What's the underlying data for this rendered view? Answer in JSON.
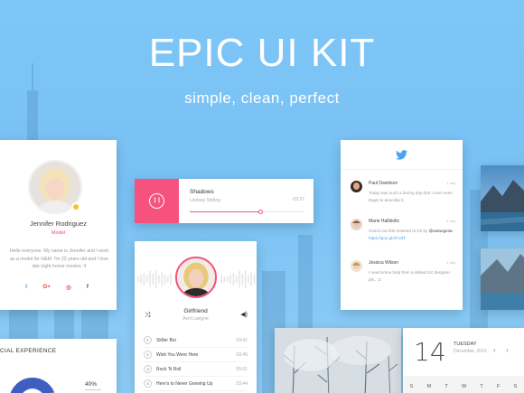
{
  "hero": {
    "title": "EPIC UI KIT",
    "subtitle": "simple, clean, perfect"
  },
  "profile": {
    "name": "Jennifer Rodriguez",
    "role": "Model",
    "bio": "Hello everyone. My name is Jennifer and I work as a model for H&M. I'm 22 years old and I love late night horror movies :3",
    "socials": [
      {
        "icon": "twitter-icon",
        "glyph": "t",
        "color": "#4aa3ee"
      },
      {
        "icon": "google-plus-icon",
        "glyph": "G+",
        "color": "#dd4b39"
      },
      {
        "icon": "dribbble-icon",
        "glyph": "◎",
        "color": "#ea4c89"
      },
      {
        "icon": "facebook-icon",
        "glyph": "f",
        "color": "#3b5998"
      }
    ]
  },
  "player": {
    "song": "Shadows",
    "artist": "Lindsey Stirling",
    "time": "-03:27",
    "progress": 0.62,
    "accent": "#f7517d"
  },
  "music": {
    "title": "Girlfriend",
    "artist": "Avril Lavigne",
    "tracks": [
      {
        "num": "1",
        "title": "Sk8er Boi",
        "duration": "03:41"
      },
      {
        "num": "2",
        "title": "Wish You Were Here",
        "duration": "03:45"
      },
      {
        "num": "3",
        "title": "Rock 'N Roll",
        "duration": "05:01"
      },
      {
        "num": "4",
        "title": "Here's to Never Growing Up",
        "duration": "03:44"
      }
    ]
  },
  "twitter": {
    "tweets": [
      {
        "name": "Paul Davidson",
        "time": "1 day",
        "text": "Today was such a boring day that I can't even begin to describe it."
      },
      {
        "name": "Marie Halliboltc",
        "time": "1 day",
        "text": "Check out this material UI Kit by ",
        "handle": "@avtangiota",
        "link": " - https://goo.gl/3Y23T"
      },
      {
        "name": "Jessica Wilson",
        "time": "1 day",
        "text": "I need some help from a skilled UX designer pls.. :3"
      }
    ]
  },
  "stats": {
    "title": "CIAL EXPERIENCE",
    "percent": "40%"
  },
  "calendar": {
    "day": "14",
    "weekday": "TUESDAY",
    "month": "December, 2015",
    "prev": "‹",
    "next": "›",
    "weekdays": [
      "S",
      "M",
      "T",
      "W",
      "T",
      "F",
      "S"
    ]
  }
}
